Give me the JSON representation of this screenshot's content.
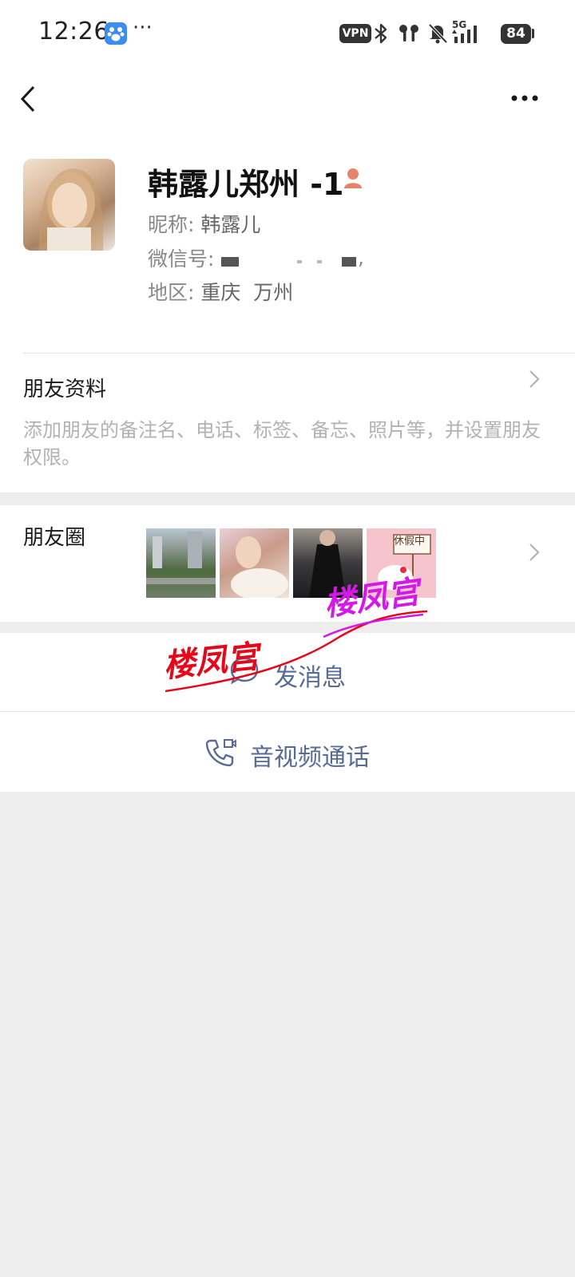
{
  "status_bar": {
    "time": "12:26",
    "more": "···",
    "vpn": "VPN",
    "network": "5G",
    "battery": "84"
  },
  "profile": {
    "name": "韩露儿郑州 -1",
    "nickname_label": "昵称: ",
    "nickname": "韩露儿",
    "wechat_id_label": "微信号: ",
    "wechat_id_tail": ",",
    "region_label": "地区: ",
    "region": "重庆  万州"
  },
  "friend_info": {
    "title": "朋友资料",
    "hint": "添加朋友的备注名、电话、标签、备忘、照片等，并设置朋友权限。"
  },
  "moments": {
    "title": "朋友圈",
    "thumb_caption": "休假中"
  },
  "actions": {
    "send_message": "发消息",
    "av_call": "音视频通话"
  },
  "watermarks": [
    "楼凤宫",
    "楼凤宫"
  ],
  "colors": {
    "link": "#576b95",
    "background": "#ededed",
    "watermark_red": "#e5081a",
    "watermark_magenta": "#d418e6"
  }
}
